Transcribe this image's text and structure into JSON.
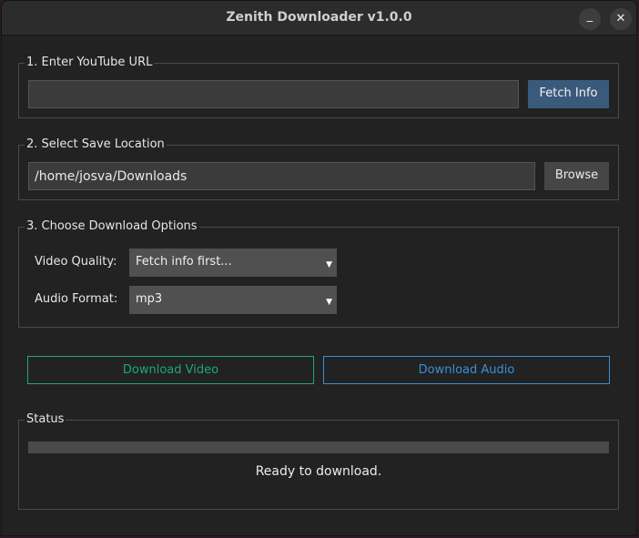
{
  "window": {
    "title": "Zenith Downloader v1.0.0",
    "minimize_glyph": "_",
    "close_glyph": "✕"
  },
  "url_section": {
    "legend": "1. Enter YouTube URL",
    "url_value": "",
    "fetch_label": "Fetch Info"
  },
  "save_section": {
    "legend": "2. Select Save Location",
    "path_value": "/home/josva/Downloads",
    "browse_label": "Browse"
  },
  "options_section": {
    "legend": "3. Choose Download Options",
    "video_quality_label": "Video Quality:",
    "video_quality_value": "Fetch info first...",
    "audio_format_label": "Audio Format:",
    "audio_format_value": "mp3"
  },
  "actions": {
    "download_video_label": "Download Video",
    "download_audio_label": "Download Audio"
  },
  "status_section": {
    "legend": "Status",
    "progress": 0,
    "message": "Ready to download."
  },
  "colors": {
    "fetch_button": "#3a5a7c",
    "video_accent": "#1fa67a",
    "audio_accent": "#3a8fd6"
  }
}
